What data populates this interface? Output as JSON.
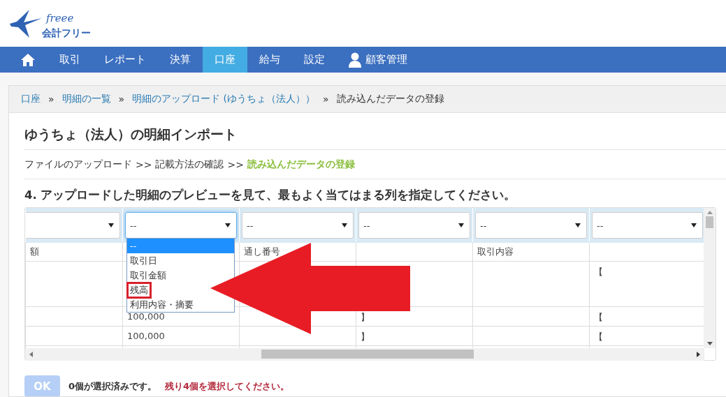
{
  "logo": {
    "wordmark": "freee",
    "product": "会計フリー"
  },
  "nav": [
    {
      "kind": "home",
      "selected": false
    },
    {
      "kind": "text",
      "label": "取引",
      "selected": false
    },
    {
      "kind": "text",
      "label": "レポート",
      "selected": false
    },
    {
      "kind": "text",
      "label": "決算",
      "selected": false
    },
    {
      "kind": "text",
      "label": "口座",
      "selected": true
    },
    {
      "kind": "text",
      "label": "給与",
      "selected": false
    },
    {
      "kind": "text",
      "label": "設定",
      "selected": false
    },
    {
      "kind": "user",
      "label": "顧客管理",
      "selected": false
    }
  ],
  "breadcrumb": {
    "separator": "»",
    "items": [
      {
        "label": "口座",
        "link": true
      },
      {
        "label": "明細の一覧",
        "link": true
      },
      {
        "label": "明細のアップロード (ゆうちょ（法人））",
        "link": true
      },
      {
        "label": "読み込んだデータの登録",
        "link": false
      }
    ]
  },
  "title": "ゆうちょ（法人）の明細インポート",
  "steps": {
    "separator": ">>",
    "items": [
      {
        "label": "ファイルのアップロード",
        "selected": false
      },
      {
        "label": "記載方法の確認",
        "selected": false
      },
      {
        "label": "読み込んだデータの登録",
        "selected": true
      }
    ]
  },
  "instruction": "4. アップロードした明細のプレビューを見て、最もよく当てはまる列を指定してください。",
  "grid": {
    "columns": [
      {
        "open": false,
        "header": "額"
      },
      {
        "value": "--",
        "open": true
      },
      {
        "value": "--",
        "open": false,
        "header": "通し番号"
      },
      {
        "value": "--",
        "open": false
      },
      {
        "value": "--",
        "open": false,
        "header": "取引内容"
      },
      {
        "value": "--",
        "open": false
      }
    ],
    "rows": [
      [
        null,
        null,
        null,
        null,
        null,
        "【"
      ],
      [
        null,
        "100,000",
        null,
        "】",
        null,
        "【"
      ],
      [
        null,
        "100,000",
        null,
        "】",
        null,
        "【"
      ]
    ],
    "dropdown": {
      "options": [
        {
          "label": "--",
          "selected": true,
          "highlighted": false
        },
        {
          "label": "取引日",
          "selected": false,
          "highlighted": false
        },
        {
          "label": "取引金額",
          "selected": false,
          "highlighted": false
        },
        {
          "label": "残高",
          "selected": false,
          "highlighted": true
        },
        {
          "label": "利用内容・摘要",
          "selected": false,
          "highlighted": false
        }
      ]
    }
  },
  "ok_button": {
    "label": "OK",
    "disabled": true
  },
  "status": {
    "count_text": "0個が選択済みです。",
    "remaining_text": "残り4個を選択してください。"
  }
}
